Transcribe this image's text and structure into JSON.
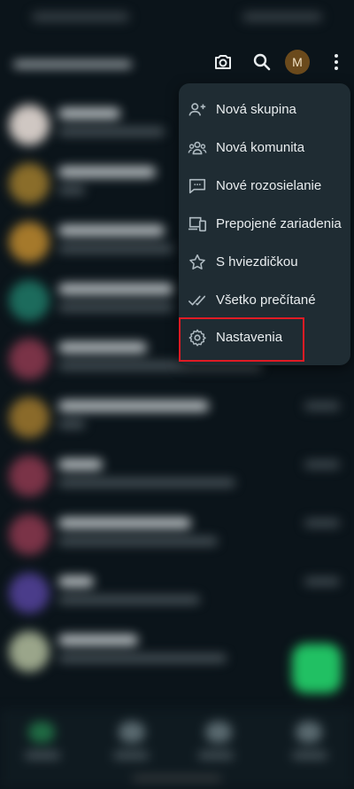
{
  "header": {
    "avatar_initial": "M"
  },
  "menu": {
    "items": [
      {
        "label": "Nová skupina",
        "icon": "add-group-icon"
      },
      {
        "label": "Nová komunita",
        "icon": "community-icon"
      },
      {
        "label": "Nové rozosielanie",
        "icon": "broadcast-icon"
      },
      {
        "label": "Prepojené zariadenia",
        "icon": "linked-devices-icon"
      },
      {
        "label": "S hviezdičkou",
        "icon": "star-icon"
      },
      {
        "label": "Všetko prečítané",
        "icon": "double-check-icon"
      },
      {
        "label": "Nastavenia",
        "icon": "gear-icon"
      }
    ]
  },
  "colors": {
    "background": "#0b141a",
    "menu_bg": "#1f2c33",
    "accent": "#21c063",
    "highlight": "#e01b24"
  }
}
